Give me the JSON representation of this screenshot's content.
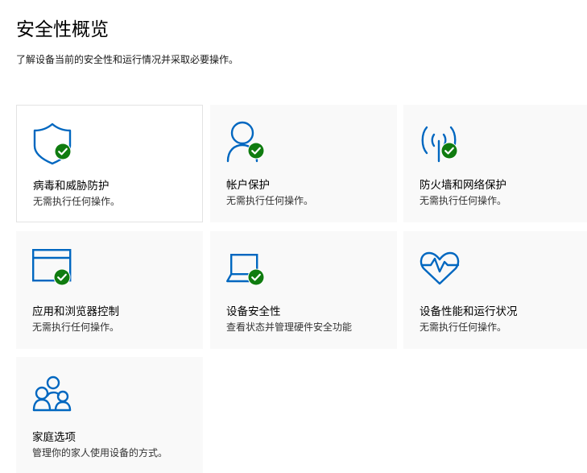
{
  "page": {
    "title": "安全性概览",
    "subtitle": "了解设备当前的安全性和运行情况并采取必要操作。"
  },
  "colors": {
    "icon_blue": "#0067c0",
    "check_green": "#107c10",
    "tile_bg": "#f9f9f9"
  },
  "tiles": [
    {
      "title": "病毒和威胁防护",
      "status": "无需执行任何操作。",
      "icon": "shield-icon",
      "checked": true
    },
    {
      "title": "帐户保护",
      "status": "无需执行任何操作。",
      "icon": "person-icon",
      "checked": true
    },
    {
      "title": "防火墙和网络保护",
      "status": "无需执行任何操作。",
      "icon": "wireless-antenna-icon",
      "checked": true
    },
    {
      "title": "应用和浏览器控制",
      "status": "无需执行任何操作。",
      "icon": "browser-window-icon",
      "checked": true
    },
    {
      "title": "设备安全性",
      "status": "查看状态并管理硬件安全功能",
      "icon": "laptop-icon",
      "checked": true
    },
    {
      "title": "设备性能和运行状况",
      "status": "无需执行任何操作。",
      "icon": "heart-pulse-icon",
      "checked": false
    },
    {
      "title": "家庭选项",
      "status": "管理你的家人使用设备的方式。",
      "icon": "family-icon",
      "checked": false
    }
  ]
}
